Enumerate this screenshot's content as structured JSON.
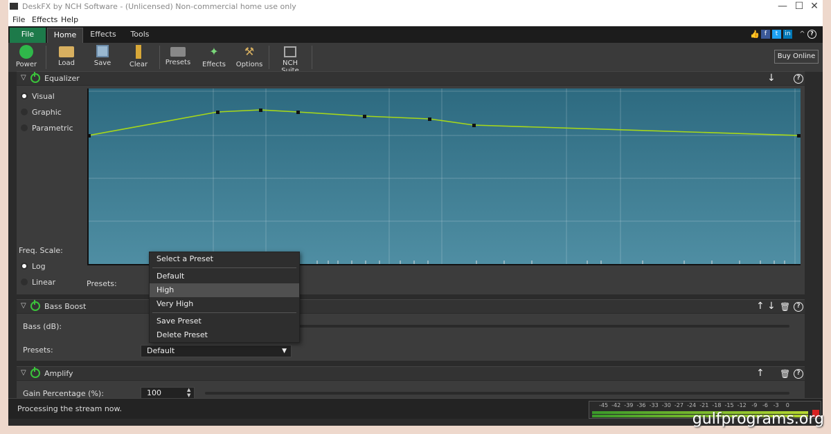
{
  "window": {
    "title": "DeskFX by NCH Software - (Unlicensed) Non-commercial home use only",
    "controls": [
      "—",
      "☐",
      "✕"
    ]
  },
  "menu": [
    "File",
    "Effects",
    "Help"
  ],
  "ribbon_tabs": [
    "File",
    "Home",
    "Effects",
    "Tools"
  ],
  "toolbar": {
    "power": "Power",
    "load": "Load",
    "save": "Save",
    "clear": "Clear",
    "presets": "Presets",
    "effects": "Effects",
    "options": "Options",
    "nch_suite": "NCH Suite",
    "buy_online": "Buy Online"
  },
  "equalizer": {
    "title": "Equalizer",
    "modes": [
      "Visual",
      "Graphic",
      "Parametric"
    ],
    "freq_scale_label": "Freq. Scale:",
    "scales": [
      "Log",
      "Linear"
    ],
    "presets_label": "Presets:"
  },
  "preset_menu": {
    "header": "Select a Preset",
    "items": [
      "Default",
      "High",
      "Very High"
    ],
    "actions": [
      "Save Preset",
      "Delete Preset"
    ],
    "highlighted": "High"
  },
  "bass_boost": {
    "title": "Bass Boost",
    "bass_label": "Bass (dB):",
    "presets_label": "Presets:",
    "preset_value": "Default"
  },
  "amplify": {
    "title": "Amplify",
    "gain_label": "Gain Percentage (%):",
    "gain_value": "100"
  },
  "status": {
    "message": "Processing the stream now.",
    "meter_scale": "-45  -42  -39  -36  -33  -30  -27  -24  -21  -18  -15  -12   -9   -6   -3    0"
  },
  "watermark": "gulfprograms.org",
  "colors": {
    "accent_green": "#1d7a4a",
    "eq_line": "#a8d818",
    "power_green": "#3bc43b"
  }
}
